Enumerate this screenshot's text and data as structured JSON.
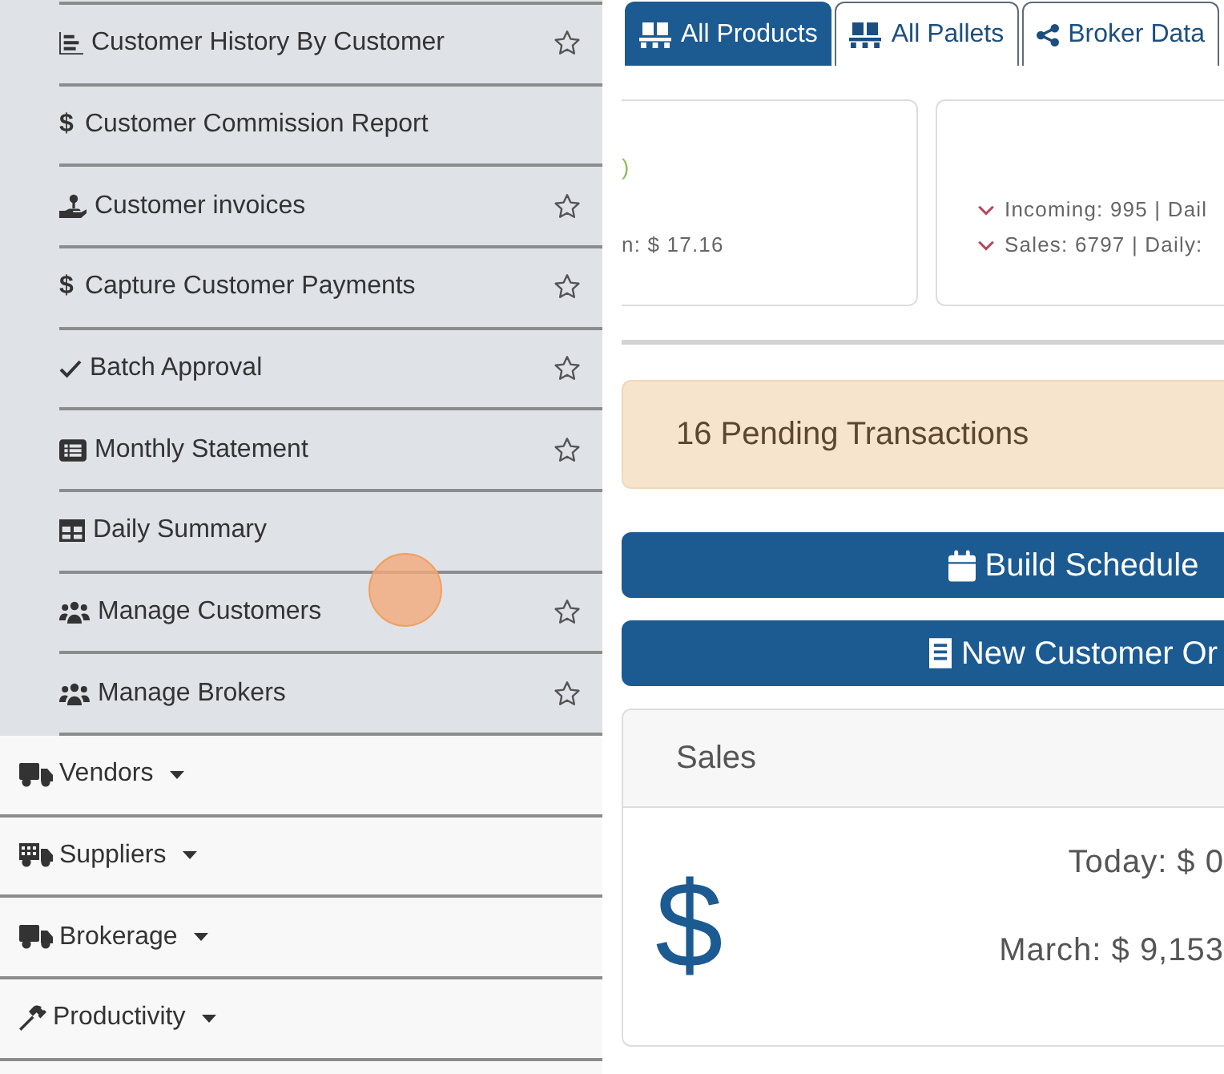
{
  "sidebar": {
    "submenu_items": [
      {
        "label": "Customer History By Customer",
        "star": true
      },
      {
        "label": "Customer Commission Report",
        "glyph": "$",
        "star": false
      },
      {
        "label": "Customer invoices",
        "star": true
      },
      {
        "label": "Capture Customer Payments",
        "glyph": "$",
        "star": true
      },
      {
        "label": "Batch Approval",
        "star": true
      },
      {
        "label": "Monthly Statement",
        "star": true
      },
      {
        "label": "Daily Summary",
        "star": false
      },
      {
        "label": "Manage Customers",
        "star": true
      },
      {
        "label": "Manage Brokers",
        "star": true
      }
    ],
    "menu_items": [
      {
        "label": "Vendors",
        "expanded": false
      },
      {
        "label": "Suppliers",
        "expanded": false
      },
      {
        "label": "Brokerage",
        "expanded": false
      },
      {
        "label": "Productivity",
        "expanded": false
      }
    ]
  },
  "click_marker": true,
  "tabs": [
    {
      "label": "All Products",
      "selected": true
    },
    {
      "label": "All Pallets",
      "selected": false
    },
    {
      "label": "Broker Data",
      "selected": false
    }
  ],
  "summary_cards": [
    {
      "lines": [
        {
          "kind": "change",
          "text": ")"
        },
        {
          "kind": "plain",
          "text": "n: $ 17.16"
        }
      ]
    },
    {
      "lines": [
        {
          "kind": "decrease",
          "text": "Incoming: 995 | Dail"
        },
        {
          "kind": "decrease",
          "text": "Sales: 6797 | Daily:"
        }
      ]
    }
  ],
  "alert": {
    "text": "16 Pending Transactions"
  },
  "buttons": [
    {
      "label": "Build Schedule"
    },
    {
      "label": "New Customer Or"
    }
  ],
  "sales_panel": {
    "title": "Sales",
    "symbol": "$",
    "lines": [
      "Today: $ 0",
      "March: $ 9,153"
    ]
  }
}
